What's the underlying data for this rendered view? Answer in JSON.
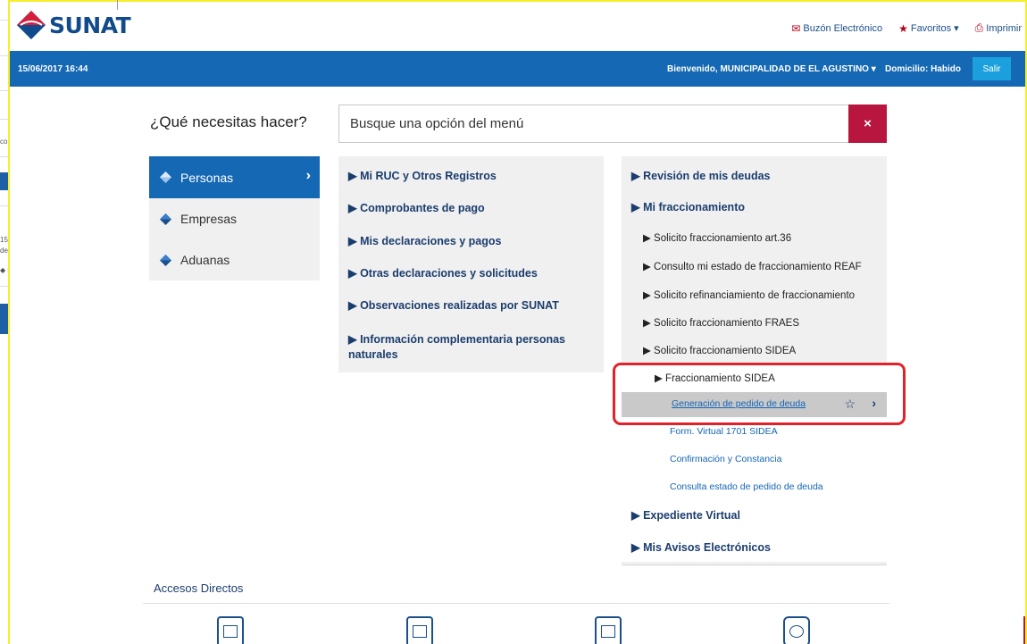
{
  "brand": {
    "name": "SUNAT"
  },
  "top_links": [
    {
      "label": "Buzón Electrónico",
      "icon": "mail-icon"
    },
    {
      "label": "Favoritos ▾",
      "icon": "star-icon"
    },
    {
      "label": "Imprimir",
      "icon": "print-icon"
    }
  ],
  "bar": {
    "datetime": "15/06/2017 16:44",
    "welcome": "Bienvenido, MUNICIPALIDAD DE EL AGUSTINO ▾",
    "domicilio": "Domicilio: Habido",
    "logout": "Salir"
  },
  "search": {
    "question": "¿Qué necesitas hacer?",
    "placeholder": "Busque una opción del menú",
    "clear": "×"
  },
  "categories": [
    {
      "label": "Personas",
      "chevron": "›"
    },
    {
      "label": "Empresas"
    },
    {
      "label": "Aduanas"
    }
  ],
  "menu_left": [
    "▶ Mi RUC y Otros Registros",
    "▶ Comprobantes de pago",
    "▶ Mis declaraciones y pagos",
    "▶ Otras declaraciones y solicitudes",
    "▶ Observaciones realizadas por SUNAT",
    "▶ Información complementaria personas naturales"
  ],
  "menu_right": {
    "deudas": "▶ Revisión de mis deudas",
    "fraccionamiento": "▶ Mi fraccionamiento",
    "sub": [
      "▶ Solicito fraccionamiento art.36",
      "▶ Consulto mi estado de fraccionamiento REAF",
      "▶ Solicito refinanciamiento de fraccionamiento",
      "▶ Solicito fraccionamiento FRAES",
      "▶ Solicito fraccionamiento SIDEA"
    ],
    "sidea_header": "▶ Fraccionamiento SIDEA",
    "sidea_items": [
      "Generación de pedido de deuda",
      "Form. Virtual 1701 SIDEA",
      "Confirmación y Constancia",
      "Consulta estado de pedido de deuda"
    ],
    "selected_star": "☆",
    "selected_go": "›",
    "expediente": "▶ Expediente Virtual",
    "avisos": "▶ Mis Avisos Electrónicos"
  },
  "accesos": {
    "title": "Accesos Directos"
  }
}
